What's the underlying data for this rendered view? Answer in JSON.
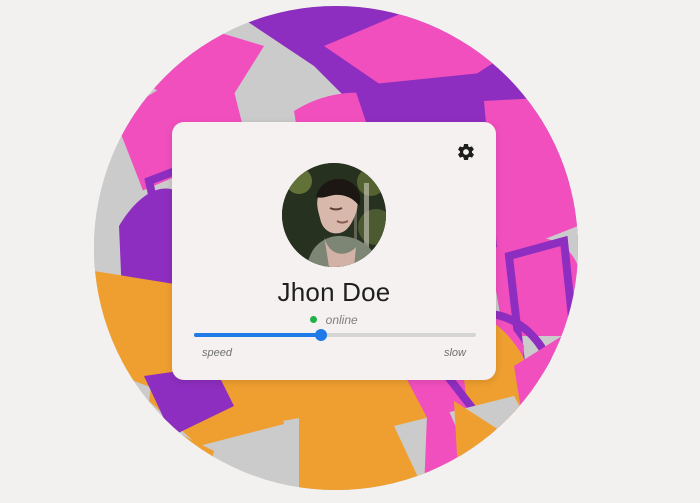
{
  "profile": {
    "name": "Jhon Doe",
    "status": "online",
    "status_color": "#21b14b",
    "avatar_alt": "profile photo"
  },
  "slider": {
    "value": 0.45,
    "left_label": "speed",
    "right_label": "slow",
    "accent": "#1f7be8"
  },
  "icons": {
    "settings": "gear-icon",
    "status": "status-dot-icon"
  }
}
